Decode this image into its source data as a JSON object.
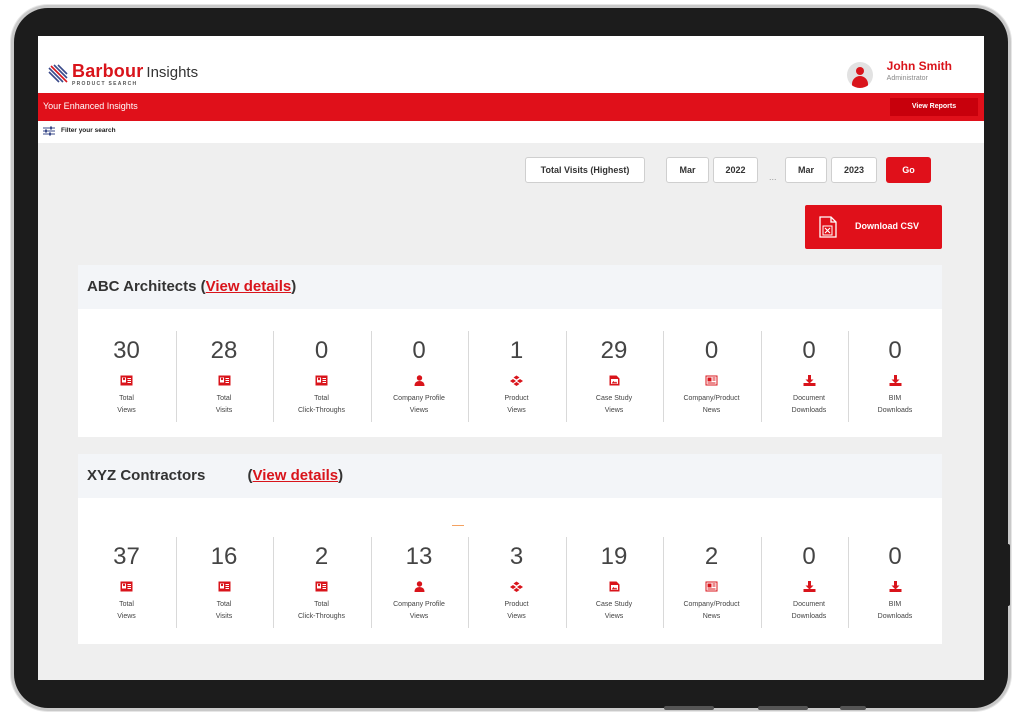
{
  "brand": {
    "name": "Barbour",
    "product": "Insights",
    "subtitle": "PRODUCT SEARCH"
  },
  "user": {
    "name": "John Smith",
    "role": "Administrator"
  },
  "redbar": {
    "title": "Your Enhanced Insights",
    "reports_label": "View Reports"
  },
  "filter": {
    "label": "Filter your search"
  },
  "controls": {
    "sort": "Total Visits (Highest)",
    "from_month": "Mar",
    "from_year": "2022",
    "separator": "...",
    "to_month": "Mar",
    "to_year": "2023",
    "go_label": "Go",
    "csv_label": "Download CSV"
  },
  "colors": {
    "accent": "#e0101a",
    "text": "#444444",
    "panel": "#f3f5f8"
  },
  "cards": [
    {
      "name": "ABC Architects",
      "link": "View details",
      "stats": [
        {
          "value": "30",
          "icon": "id-card-icon",
          "line1": "Total",
          "line2": "Views"
        },
        {
          "value": "28",
          "icon": "id-card-icon",
          "line1": "Total",
          "line2": "Visits"
        },
        {
          "value": "0",
          "icon": "id-card-icon",
          "line1": "Total",
          "line2": "Click-Throughs"
        },
        {
          "value": "0",
          "icon": "user-icon",
          "line1": "Company Profile",
          "line2": "Views"
        },
        {
          "value": "1",
          "icon": "cubes-icon",
          "line1": "Product",
          "line2": "Views"
        },
        {
          "value": "29",
          "icon": "image-file-icon",
          "line1": "Case Study",
          "line2": "Views"
        },
        {
          "value": "0",
          "icon": "newspaper-icon",
          "line1": "Company/Product",
          "line2": "News"
        },
        {
          "value": "0",
          "icon": "download-icon",
          "line1": "Document",
          "line2": "Downloads"
        },
        {
          "value": "0",
          "icon": "download-icon",
          "line1": "BIM",
          "line2": "Downloads"
        }
      ]
    },
    {
      "name": "XYZ Contractors",
      "link": "View details",
      "stats": [
        {
          "value": "37",
          "icon": "id-card-icon",
          "line1": "Total",
          "line2": "Views"
        },
        {
          "value": "16",
          "icon": "id-card-icon",
          "line1": "Total",
          "line2": "Visits"
        },
        {
          "value": "2",
          "icon": "id-card-icon",
          "line1": "Total",
          "line2": "Click-Throughs"
        },
        {
          "value": "13",
          "icon": "user-icon",
          "line1": "Company Profile",
          "line2": "Views"
        },
        {
          "value": "3",
          "icon": "cubes-icon",
          "line1": "Product",
          "line2": "Views"
        },
        {
          "value": "19",
          "icon": "image-file-icon",
          "line1": "Case Study",
          "line2": "Views"
        },
        {
          "value": "2",
          "icon": "newspaper-icon",
          "line1": "Company/Product",
          "line2": "News"
        },
        {
          "value": "0",
          "icon": "download-icon",
          "line1": "Document",
          "line2": "Downloads"
        },
        {
          "value": "0",
          "icon": "download-icon",
          "line1": "BIM",
          "line2": "Downloads"
        }
      ]
    }
  ]
}
